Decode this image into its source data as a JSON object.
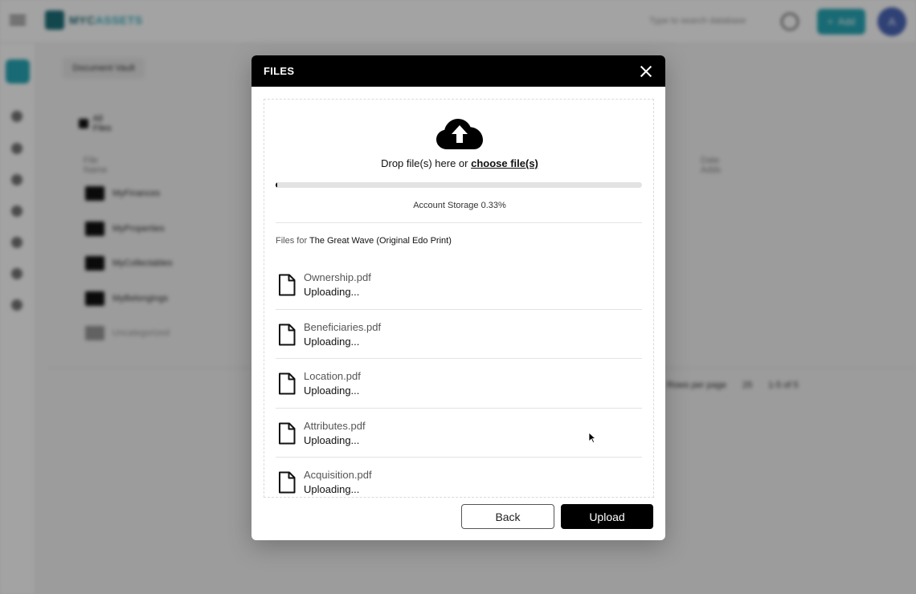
{
  "app": {
    "logo": {
      "prefix": "MYC",
      "suffix": "ASSETS"
    },
    "search_placeholder": "Type to search database",
    "add_label": "Add",
    "avatar_initial": "A",
    "vault_tab": "Document Vault",
    "breadcrumb": "All Files",
    "columns": {
      "name": "File Name",
      "date": "Date Adds"
    },
    "folders": [
      {
        "label": "MyFinances"
      },
      {
        "label": "MyProperties"
      },
      {
        "label": "MyCollectables"
      },
      {
        "label": "MyBelongings"
      },
      {
        "label": "Uncategorized"
      }
    ],
    "pager": {
      "rows_label": "Rows per page",
      "rows_value": "25",
      "range": "1-5 of 5"
    }
  },
  "modal": {
    "title": "FILES",
    "drop_text": "Drop file(s) here or ",
    "drop_link": "choose file(s)",
    "storage_percent": 0.33,
    "storage_label": "Account Storage 0.33%",
    "files_for_prefix": "Files for ",
    "files_for_name": "The Great Wave (Original Edo Print)",
    "files": [
      {
        "name": "Ownership.pdf",
        "status": "Uploading..."
      },
      {
        "name": "Beneficiaries.pdf",
        "status": "Uploading..."
      },
      {
        "name": "Location.pdf",
        "status": "Uploading..."
      },
      {
        "name": "Attributes.pdf",
        "status": "Uploading..."
      },
      {
        "name": "Acquisition.pdf",
        "status": "Uploading..."
      }
    ],
    "back_label": "Back",
    "upload_label": "Upload"
  }
}
